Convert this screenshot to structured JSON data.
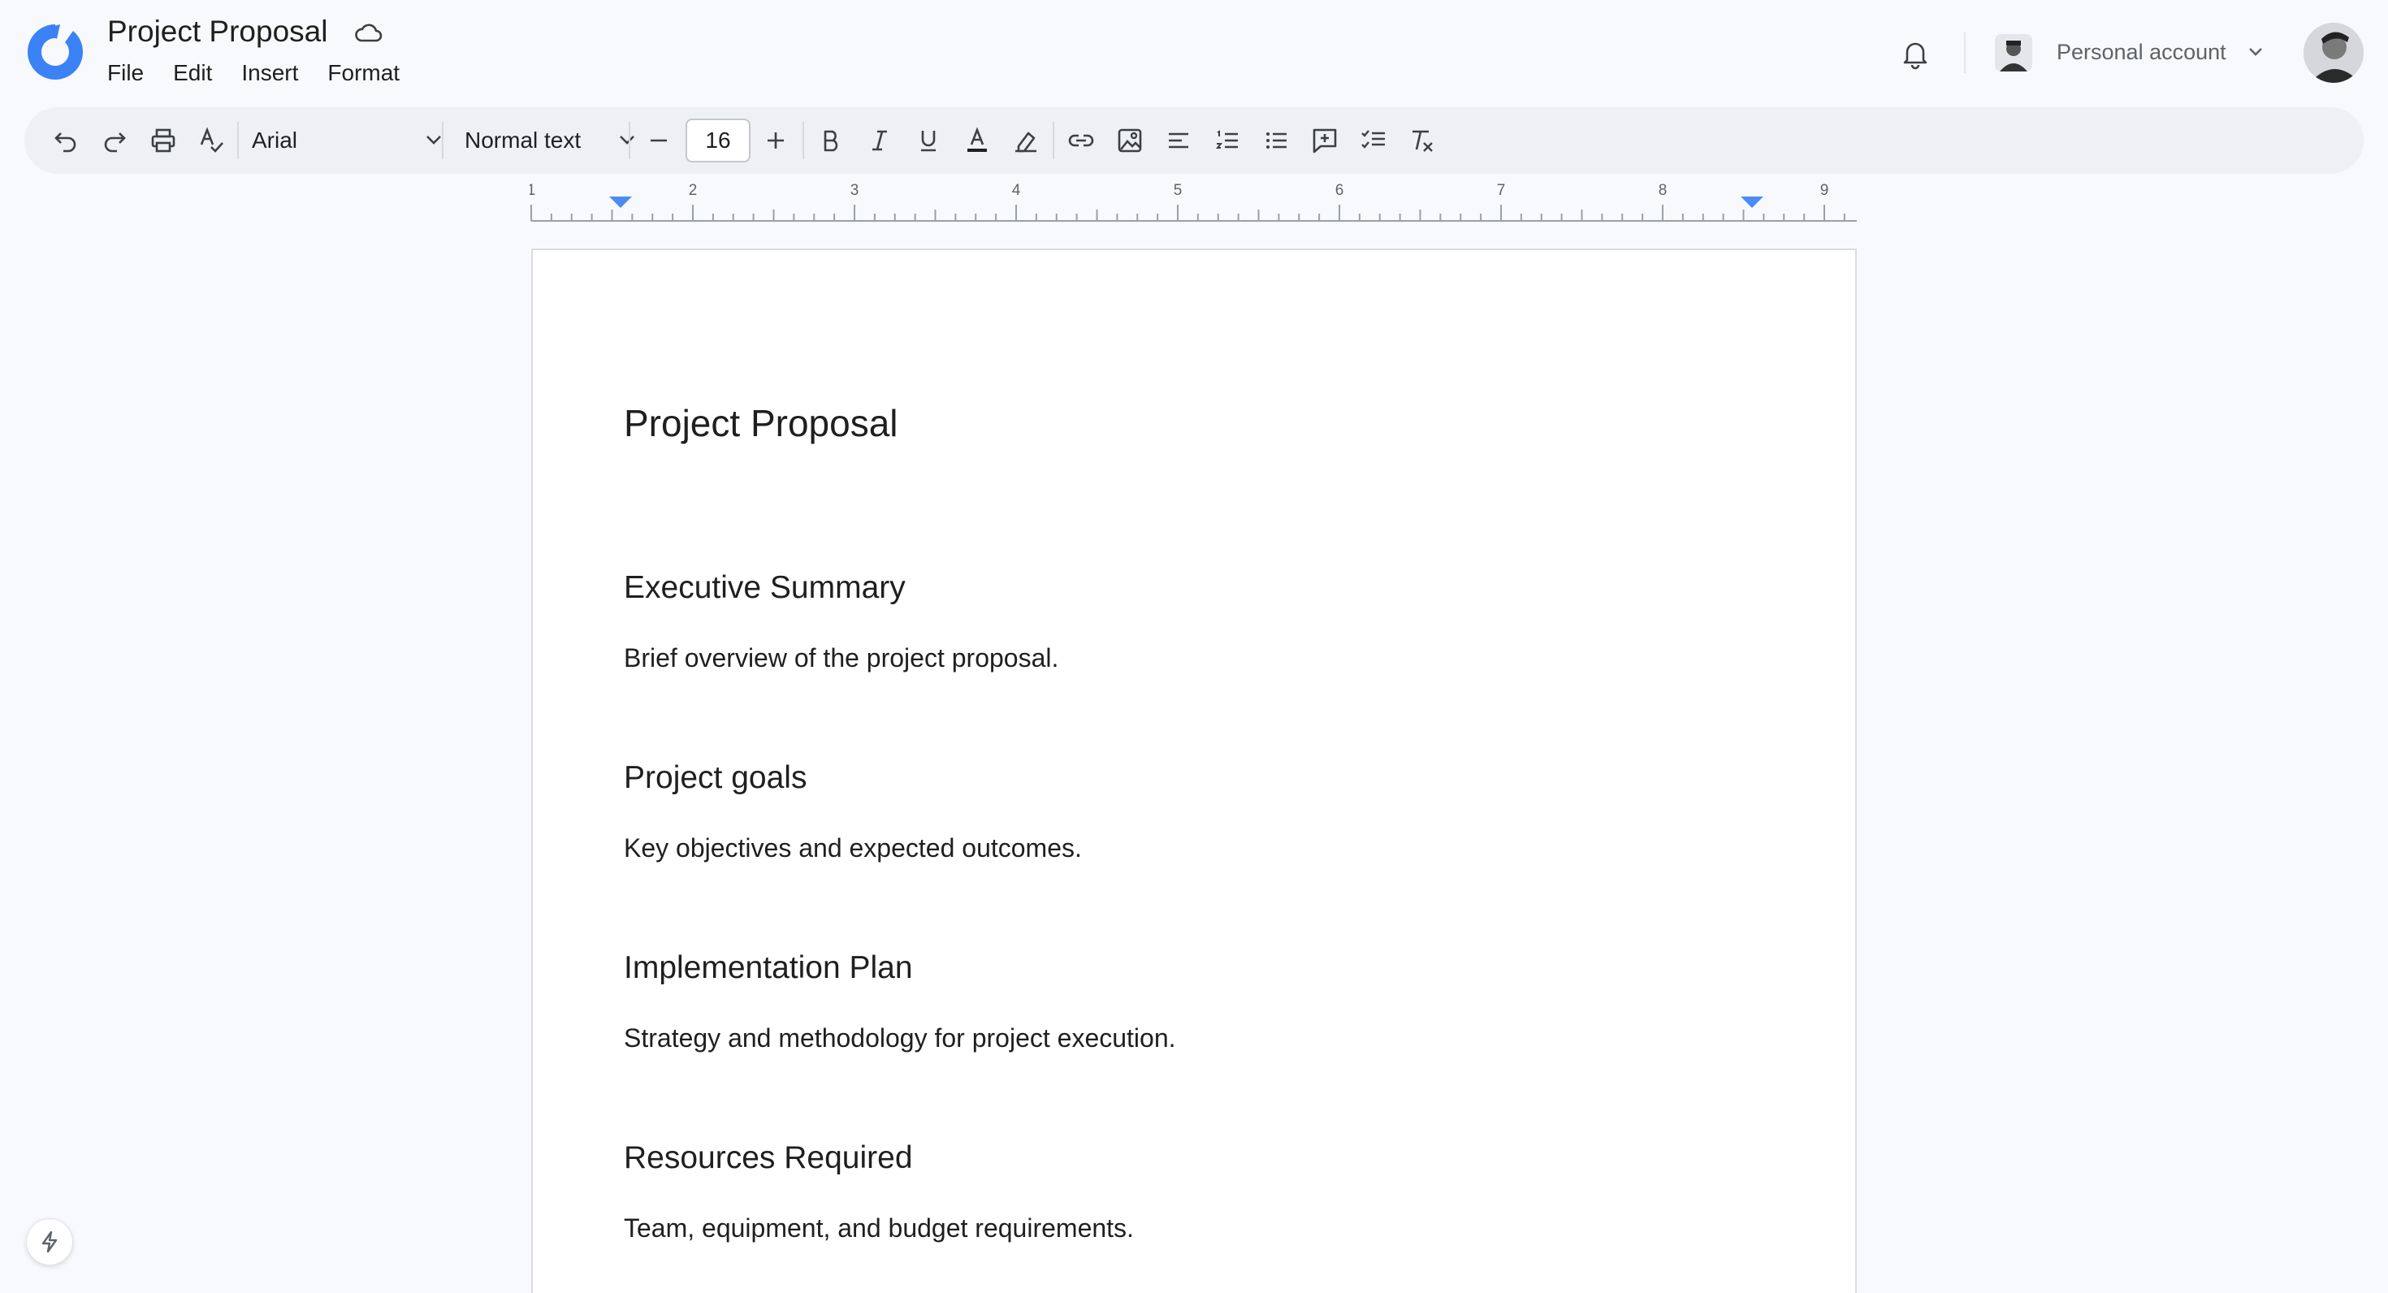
{
  "app": {
    "doc_title": "Project Proposal",
    "menu": [
      "File",
      "Edit",
      "Insert",
      "Format"
    ],
    "account_label": "Personal account",
    "brand_color": "#3b82f6"
  },
  "toolbar": {
    "font": "Arial",
    "text_style": "Normal text",
    "font_size": "16",
    "icons": [
      "undo-icon",
      "redo-icon",
      "print-icon",
      "spellcheck-icon",
      "minus-icon",
      "plus-icon",
      "bold-icon",
      "italic-icon",
      "underline-icon",
      "text-color-icon",
      "highlight-icon",
      "link-icon",
      "image-icon",
      "align-left-icon",
      "numbered-list-icon",
      "bulleted-list-icon",
      "add-comment-icon",
      "checklist-icon",
      "clear-formatting-icon"
    ]
  },
  "ruler": {
    "numbers": [
      "1",
      "2",
      "3",
      "4",
      "5",
      "6",
      "7",
      "8",
      "9"
    ],
    "marker_color": "#4c8bf5"
  },
  "document": {
    "title": "Project Proposal",
    "sections": [
      {
        "heading": "Executive Summary",
        "body": "Brief overview of the project proposal."
      },
      {
        "heading": "Project goals",
        "body": "Key objectives and expected outcomes."
      },
      {
        "heading": "Implementation Plan",
        "body": "Strategy and methodology for project execution."
      },
      {
        "heading": "Resources Required",
        "body": "Team, equipment, and budget requirements."
      }
    ]
  }
}
